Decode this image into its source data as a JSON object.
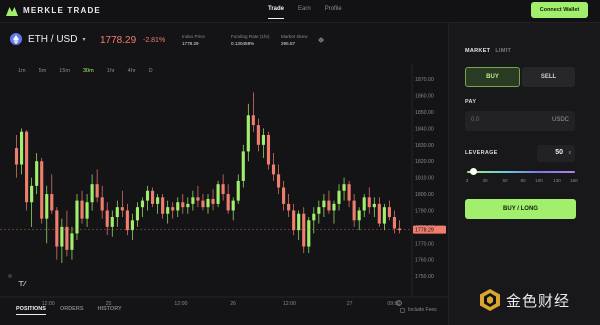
{
  "header": {
    "brand": "MERKLE TRADE",
    "nav": [
      "Trade",
      "Earn",
      "Profile"
    ],
    "connect_label": "Connect Wallet"
  },
  "market": {
    "pair": "ETH / USD",
    "price": "1778.29",
    "change": "-2.81%",
    "stats": [
      {
        "label": "Index Price",
        "value": "1778.29"
      },
      {
        "label": "Funding Rate (1hr)",
        "value": "0.130459%"
      },
      {
        "label": "Market Skew",
        "value": "295.57"
      }
    ]
  },
  "timeframes": [
    "1m",
    "5m",
    "15m",
    "30m",
    "1hr",
    "4hr",
    "D"
  ],
  "active_timeframe": "30m",
  "chart_data": {
    "type": "candlestick",
    "y_ticks": [
      "1870.00",
      "1860.00",
      "1850.00",
      "1840.00",
      "1830.00",
      "1820.00",
      "1810.00",
      "1800.00",
      "1790.00",
      "1780.00",
      "1770.00",
      "1760.00",
      "1750.00"
    ],
    "ylim": [
      1747,
      1875
    ],
    "x_ticks": [
      "12:00",
      "25",
      "12:00",
      "26",
      "12:00",
      "27",
      "09:00"
    ],
    "x_tick_positions": [
      0.1,
      0.25,
      0.43,
      0.56,
      0.7,
      0.85,
      0.96
    ],
    "last_price_label": "1778.29",
    "colors": {
      "up": "#a2ef6e",
      "down": "#f07e6e"
    },
    "candles": [
      [
        1828,
        1836,
        1810,
        1818
      ],
      [
        1818,
        1840,
        1812,
        1838
      ],
      [
        1838,
        1839,
        1790,
        1795
      ],
      [
        1795,
        1810,
        1780,
        1805
      ],
      [
        1805,
        1825,
        1800,
        1820
      ],
      [
        1820,
        1822,
        1782,
        1785
      ],
      [
        1785,
        1805,
        1770,
        1800
      ],
      [
        1800,
        1812,
        1788,
        1790
      ],
      [
        1790,
        1792,
        1760,
        1768
      ],
      [
        1768,
        1785,
        1758,
        1780
      ],
      [
        1780,
        1790,
        1762,
        1766
      ],
      [
        1766,
        1780,
        1760,
        1776
      ],
      [
        1776,
        1800,
        1772,
        1796
      ],
      [
        1796,
        1802,
        1782,
        1785
      ],
      [
        1785,
        1800,
        1780,
        1795
      ],
      [
        1795,
        1812,
        1790,
        1806
      ],
      [
        1806,
        1815,
        1795,
        1798
      ],
      [
        1798,
        1805,
        1785,
        1790
      ],
      [
        1790,
        1795,
        1775,
        1780
      ],
      [
        1780,
        1790,
        1774,
        1786
      ],
      [
        1786,
        1796,
        1780,
        1792
      ],
      [
        1792,
        1802,
        1786,
        1790
      ],
      [
        1790,
        1794,
        1775,
        1778
      ],
      [
        1778,
        1788,
        1772,
        1784
      ],
      [
        1784,
        1795,
        1780,
        1792
      ],
      [
        1792,
        1798,
        1786,
        1796
      ],
      [
        1796,
        1805,
        1790,
        1802
      ],
      [
        1802,
        1804,
        1792,
        1794
      ],
      [
        1794,
        1800,
        1788,
        1798
      ],
      [
        1798,
        1800,
        1785,
        1788
      ],
      [
        1788,
        1796,
        1782,
        1792
      ],
      [
        1792,
        1795,
        1785,
        1790
      ],
      [
        1790,
        1798,
        1786,
        1795
      ],
      [
        1795,
        1800,
        1788,
        1792
      ],
      [
        1792,
        1798,
        1788,
        1794
      ],
      [
        1794,
        1802,
        1790,
        1798
      ],
      [
        1798,
        1805,
        1792,
        1796
      ],
      [
        1796,
        1800,
        1790,
        1792
      ],
      [
        1792,
        1800,
        1788,
        1797
      ],
      [
        1797,
        1803,
        1790,
        1794
      ],
      [
        1794,
        1808,
        1792,
        1806
      ],
      [
        1806,
        1812,
        1796,
        1800
      ],
      [
        1800,
        1806,
        1788,
        1790
      ],
      [
        1790,
        1798,
        1784,
        1796
      ],
      [
        1796,
        1812,
        1794,
        1808
      ],
      [
        1808,
        1830,
        1804,
        1826
      ],
      [
        1826,
        1855,
        1820,
        1848
      ],
      [
        1848,
        1862,
        1838,
        1842
      ],
      [
        1842,
        1846,
        1826,
        1830
      ],
      [
        1830,
        1840,
        1822,
        1836
      ],
      [
        1836,
        1838,
        1815,
        1818
      ],
      [
        1818,
        1825,
        1808,
        1812
      ],
      [
        1812,
        1818,
        1800,
        1804
      ],
      [
        1804,
        1808,
        1790,
        1794
      ],
      [
        1794,
        1800,
        1786,
        1790
      ],
      [
        1790,
        1794,
        1775,
        1778
      ],
      [
        1778,
        1790,
        1772,
        1788
      ],
      [
        1788,
        1792,
        1764,
        1768
      ],
      [
        1768,
        1786,
        1764,
        1784
      ],
      [
        1784,
        1792,
        1776,
        1788
      ],
      [
        1788,
        1796,
        1782,
        1792
      ],
      [
        1792,
        1800,
        1786,
        1796
      ],
      [
        1796,
        1802,
        1788,
        1790
      ],
      [
        1790,
        1796,
        1782,
        1794
      ],
      [
        1794,
        1806,
        1790,
        1802
      ],
      [
        1802,
        1810,
        1796,
        1806
      ],
      [
        1806,
        1808,
        1792,
        1796
      ],
      [
        1796,
        1800,
        1780,
        1784
      ],
      [
        1784,
        1792,
        1778,
        1790
      ],
      [
        1790,
        1800,
        1786,
        1798
      ],
      [
        1798,
        1804,
        1788,
        1792
      ],
      [
        1792,
        1798,
        1786,
        1794
      ],
      [
        1794,
        1798,
        1780,
        1782
      ],
      [
        1782,
        1794,
        1778,
        1792
      ],
      [
        1792,
        1796,
        1784,
        1786
      ],
      [
        1786,
        1790,
        1776,
        1779
      ],
      [
        1779,
        1784,
        1776,
        1778
      ]
    ]
  },
  "bottom_tabs": [
    "POSITIONS",
    "ORDERS",
    "HISTORY"
  ],
  "include_fees_label": "Include Fees",
  "trade": {
    "market_tabs": [
      "MARKET",
      "LIMIT"
    ],
    "buy_label": "BUY",
    "sell_label": "SELL",
    "pay_label": "PAY",
    "pay_placeholder": "0.0",
    "pay_unit": "USDC",
    "leverage_label": "LEVERAGE",
    "leverage_value": "50",
    "leverage_unit": "x",
    "leverage_ticks": [
      "3",
      "30",
      "50",
      "80",
      "100",
      "130",
      "150"
    ],
    "cta_label": "BUY / LONG"
  },
  "watermark": {
    "text": "金色财经"
  }
}
